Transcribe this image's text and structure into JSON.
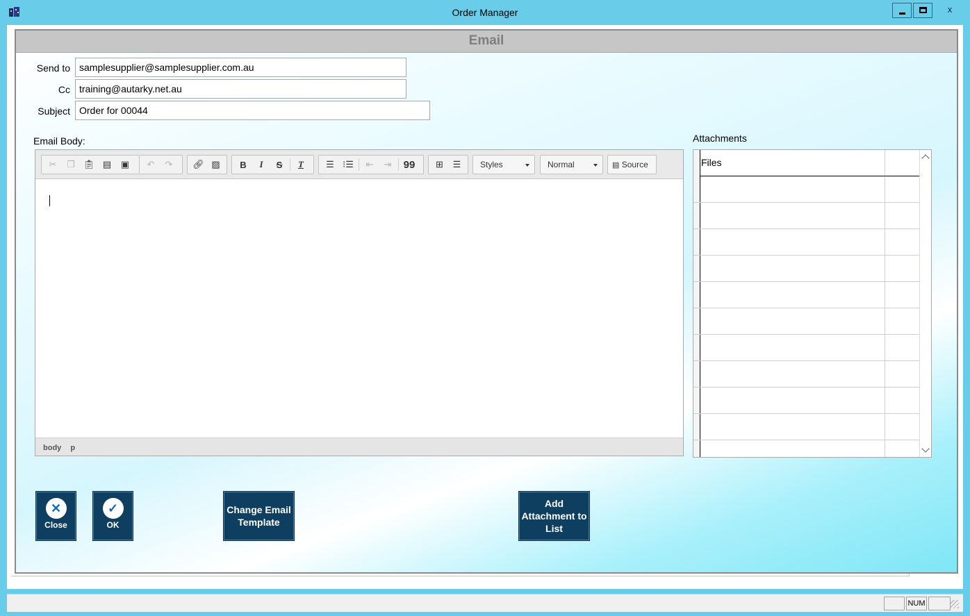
{
  "window": {
    "title": "Order Manager",
    "close_glyph": "x"
  },
  "dialog": {
    "heading": "Email"
  },
  "form": {
    "send_to_label": "Send to",
    "send_to_value": "samplesupplier@samplesupplier.com.au",
    "cc_label": "Cc",
    "cc_value": "training@autarky.net.au",
    "subject_label": "Subject",
    "subject_value": "Order for 00044",
    "body_label": "Email Body:"
  },
  "editor": {
    "toolbar": {
      "clipboard": [
        "cut-icon",
        "copy-icon",
        "paste-icon",
        "paste-text-icon",
        "paste-word-icon"
      ],
      "history": [
        "undo-icon",
        "redo-icon"
      ],
      "insert": [
        "link-icon",
        "image-icon"
      ],
      "format": {
        "bold": "B",
        "italic": "I",
        "strike": "S",
        "clear": "T"
      },
      "styles_label": "Styles",
      "format_label": "Normal",
      "source_label": "Source",
      "quote_glyph": "99"
    },
    "path": [
      "body",
      "p"
    ]
  },
  "attachments": {
    "label": "Attachments",
    "column": "Files",
    "rows": [
      "",
      "",
      "",
      "",
      "",
      "",
      "",
      "",
      "",
      "",
      ""
    ]
  },
  "buttons": {
    "close": "Close",
    "ok": "OK",
    "change_template": "Change Email Template",
    "add_attachment": "Add Attachment to List"
  },
  "status": {
    "num": "NUM"
  },
  "colors": {
    "titlebar": "#69cdea",
    "button": "#0e3f60",
    "dialog_head": "#c6c6c6"
  }
}
